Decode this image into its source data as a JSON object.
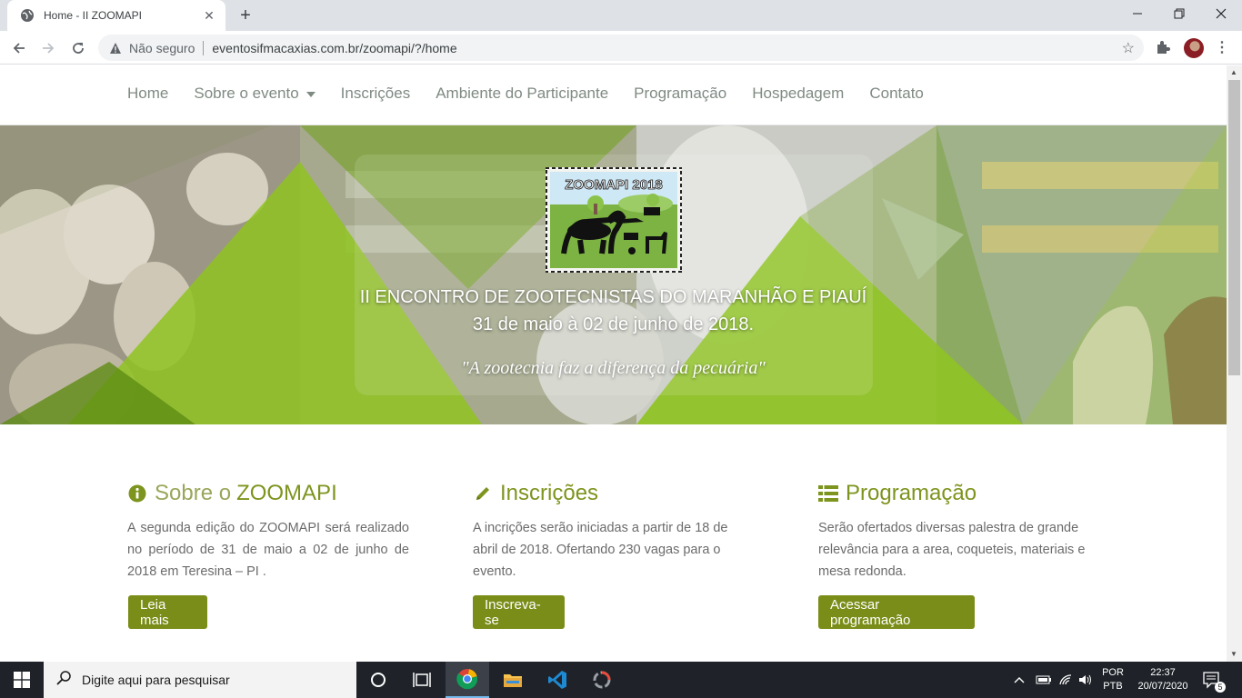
{
  "browser": {
    "tab_title": "Home - II ZOOMAPI",
    "new_tab": "+",
    "security_label": "Não seguro",
    "url": "eventosifmacaxias.com.br/zoomapi/?/home"
  },
  "site_nav": {
    "items": [
      "Home",
      "Sobre o evento",
      "Inscrições",
      "Ambiente do Participante",
      "Programação",
      "Hospedagem",
      "Contato"
    ]
  },
  "hero": {
    "logo_text": "ZOOMAPI 2018",
    "line1": "II ENCONTRO DE ZOOTECNISTAS DO MARANHÃO E PIAUÍ",
    "line2": "31 de maio à 02 de junho de 2018.",
    "motto": "\"A zootecnia faz a diferença da pecuária\""
  },
  "cards": [
    {
      "title_prefix": "Sobre o",
      "title": "ZOOMAPI",
      "text": "A segunda edição do ZOOMAPI será realizado no período de 31 de maio a 02 de junho de 2018 em Teresina – PI .",
      "button": "Leia mais"
    },
    {
      "title": "Inscrições",
      "text": "A incrições serão iniciadas a partir de 18 de abril de 2018. Ofertando 230 vagas para o evento.",
      "button": "Inscreva-se"
    },
    {
      "title": "Programação",
      "text": "Serão ofertados diversas palestra de grande relevância para a area, coqueteis, materiais e mesa redonda.",
      "button": "Acessar programação"
    }
  ],
  "taskbar": {
    "search_placeholder": "Digite aqui para pesquisar",
    "lang_top": "POR",
    "lang_bottom": "PTB",
    "time": "22:37",
    "date": "20/07/2020",
    "notifications": "5"
  },
  "colors": {
    "accent_green": "#7a8d18",
    "title_green": "#7d941e",
    "nav_text": "#7f8a82"
  }
}
